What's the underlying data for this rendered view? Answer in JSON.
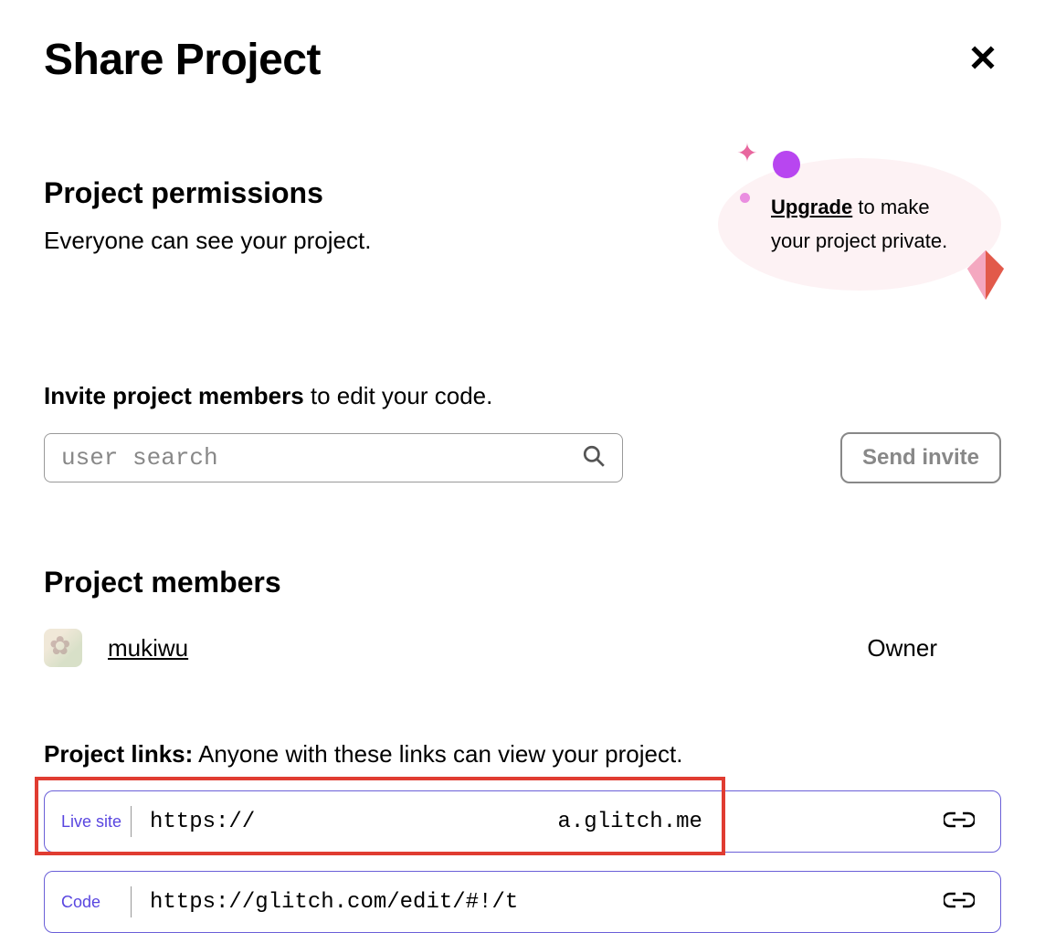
{
  "header": {
    "title": "Share Project"
  },
  "permissions": {
    "heading": "Project permissions",
    "description": "Everyone can see your project."
  },
  "upgrade": {
    "link_text": "Upgrade",
    "text_rest": " to make your project private."
  },
  "invite": {
    "heading_bold": "Invite project members",
    "heading_rest": " to edit your code.",
    "placeholder": "user search",
    "button": "Send invite"
  },
  "members": {
    "heading": "Project members",
    "list": [
      {
        "name": "mukiwu",
        "role": "Owner"
      }
    ]
  },
  "links": {
    "heading_bold": "Project links:",
    "heading_rest": " Anyone with these links can view your project.",
    "items": [
      {
        "label": "Live site",
        "url_prefix": "https://",
        "url_suffix": "a.glitch.me"
      },
      {
        "label": "Code",
        "url_prefix": "https://glitch.com/edit/#!/t",
        "url_suffix": ""
      }
    ]
  }
}
